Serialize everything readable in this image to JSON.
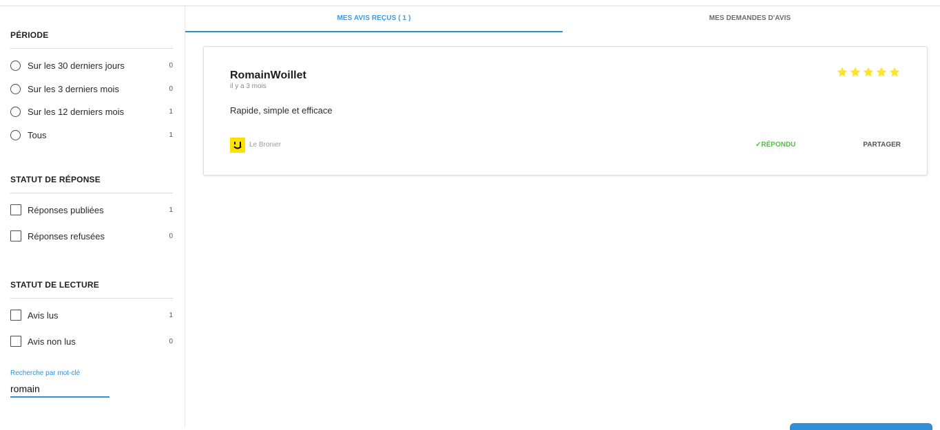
{
  "sidebar": {
    "period": {
      "title": "PÉRIODE",
      "options": [
        {
          "label": "Sur les 30 derniers jours",
          "count": "0"
        },
        {
          "label": "Sur les 3 derniers mois",
          "count": "0"
        },
        {
          "label": "Sur les 12 derniers mois",
          "count": "1"
        },
        {
          "label": "Tous",
          "count": "1"
        }
      ]
    },
    "response_status": {
      "title": "STATUT DE RÉPONSE",
      "options": [
        {
          "label": "Réponses publiées",
          "count": "1"
        },
        {
          "label": "Réponses refusées",
          "count": "0"
        }
      ]
    },
    "read_status": {
      "title": "STATUT DE LECTURE",
      "options": [
        {
          "label": "Avis lus",
          "count": "1"
        },
        {
          "label": "Avis non lus",
          "count": "0"
        }
      ]
    },
    "search": {
      "label": "Recherche par mot-clé",
      "value": "romain"
    }
  },
  "tabs": {
    "received": "MES AVIS REÇUS  ( 1 )",
    "requests": "MES DEMANDES D'AVIS"
  },
  "review": {
    "author": "RomainWoillet",
    "date": "il y a 3 mois",
    "rating": 5,
    "text": "Rapide, simple et efficace",
    "brand": "Le Bronier",
    "status": "✓RÉPONDU",
    "share": "PARTAGER"
  },
  "colors": {
    "accent": "#2f8fd6",
    "star": "#ffe32a",
    "replied": "#5ab84d",
    "brand_logo": "#ffe100"
  },
  "icons": {
    "star": "star-icon",
    "brand": "smiley-logo-icon",
    "radio": "radio-button",
    "checkbox": "checkbox"
  }
}
